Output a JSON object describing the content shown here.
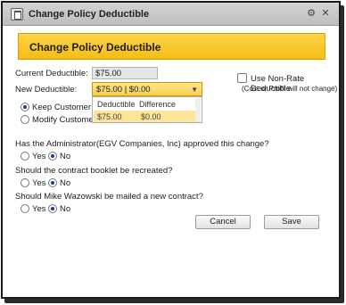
{
  "window": {
    "title": "Change Policy Deductible",
    "icons": [
      "gear-icon",
      "close-icon"
    ]
  },
  "header": {
    "title": "Change Policy Deductible",
    "accent": "#f7c520"
  },
  "current_deductible": {
    "label": "Current Deductible:",
    "value": "$75.00"
  },
  "non_rate": {
    "label": "Use Non-Rate Deductible",
    "note": "(Cost or Profit will not change)",
    "checked": false
  },
  "new_deductible": {
    "label": "New Deductible:",
    "selected": "$75.00   |  $0.00",
    "columns": [
      "Deductible",
      "Difference"
    ],
    "options": [
      {
        "deductible": "$75.00",
        "difference": "$0.00"
      }
    ]
  },
  "cost_options": {
    "keep_label": "Keep Customer Co",
    "modify_label": "Modify Customer Co"
  },
  "questions": [
    {
      "text": "Has the Administrator(EGV Companies, Inc) approved this change?",
      "yes": "Yes",
      "no": "No",
      "selected": "No"
    },
    {
      "text": "Should the contract booklet be recreated?",
      "yes": "Yes",
      "no": "No",
      "selected": "No"
    },
    {
      "text": "Should Mike Wazowski be mailed a new contract?",
      "yes": "Yes",
      "no": "No",
      "selected": "No"
    }
  ],
  "buttons": {
    "cancel": "Cancel",
    "save": "Save"
  }
}
